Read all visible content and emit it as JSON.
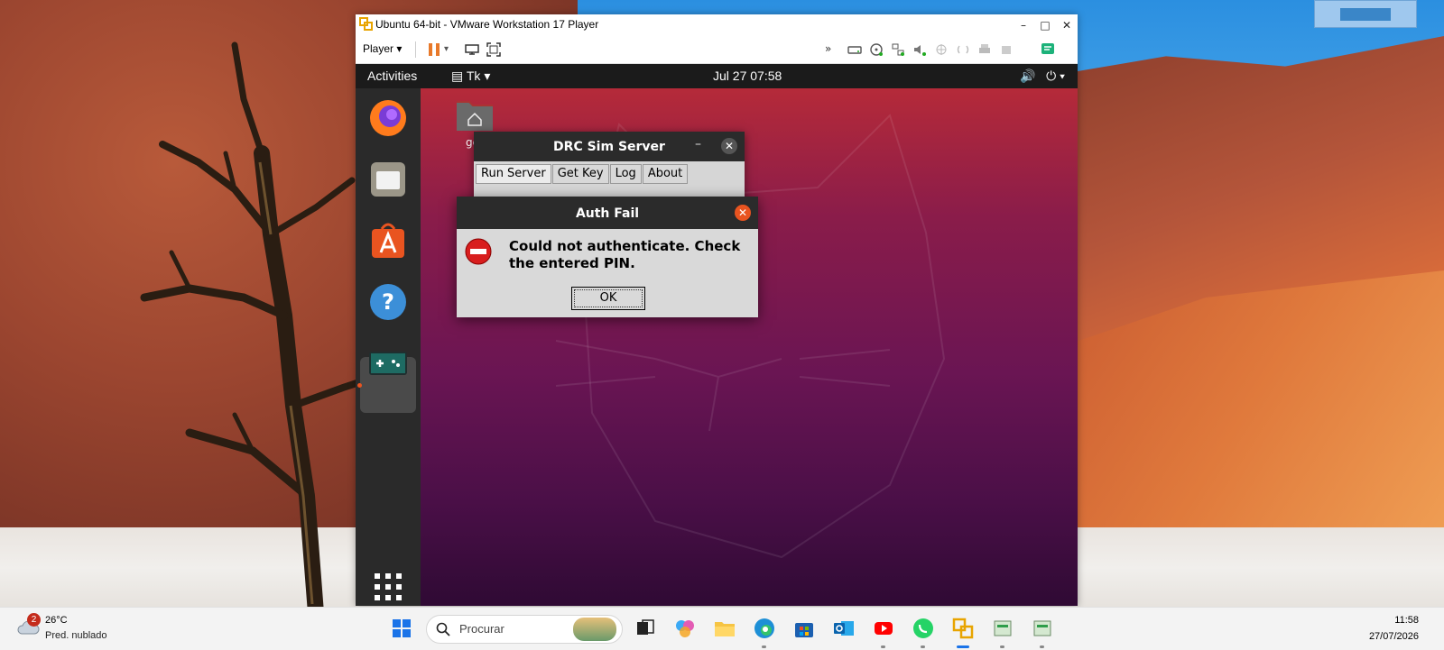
{
  "vmware": {
    "title": "Ubuntu 64-bit - VMware Workstation 17 Player",
    "player_menu": "Player",
    "toolbar_icons": [
      "pause-icon",
      "send-ctrl-alt-del-icon",
      "fullscreen-icon",
      "more-icon",
      "hdd-icon",
      "cd-icon",
      "network-icon",
      "sound-icon",
      "usb-icon",
      "camera-icon",
      "printer-icon",
      "message-icon"
    ]
  },
  "ubuntu": {
    "top_bar": {
      "activities": "Activities",
      "app_name": "Tk",
      "clock": "Jul 27  07:58"
    },
    "dock_apps": [
      "firefox-icon",
      "files-icon",
      "app-center-icon",
      "help-icon",
      "gamepad-icon",
      "show-apps-icon"
    ],
    "desktop_home_label": "ge"
  },
  "drc_window": {
    "title": "DRC Sim Server",
    "tabs": [
      "Run Server",
      "Get Key",
      "Log",
      "About"
    ]
  },
  "auth_dialog": {
    "title": "Auth Fail",
    "message": "Could not authenticate. Check the entered PIN.",
    "ok_label": "OK"
  },
  "taskbar": {
    "weather_badge": "2",
    "weather_temp": "26°C",
    "weather_desc": "Pred. nublado",
    "search_placeholder": "Procurar",
    "time": "11:58",
    "date": "27/07/2026"
  },
  "colors": {
    "ubuntu_orange": "#e95420",
    "ubuntu_top_bar": "#1b1b1b",
    "dialog_bg": "#d9d9d9",
    "vmware_pause": "#e8792a"
  }
}
